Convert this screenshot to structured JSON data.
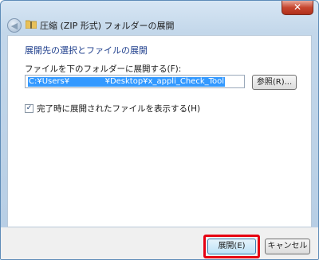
{
  "window": {
    "title": "圧縮 (ZIP 形式) フォルダーの展開",
    "close_glyph": "✕",
    "back_icon": "back-arrow-icon",
    "folder_icon": "zip-folder-icon"
  },
  "content": {
    "heading": "展開先の選択とファイルの展開",
    "destination_label": "ファイルを下のフォルダーに展開する(F):",
    "destination_value": "C:¥Users¥              ¥Desktop¥x_appli_Check_Tool",
    "browse_button": "参照(R)...",
    "show_files_checkbox": {
      "checked": true,
      "label": "完了時に展開されたファイルを表示する(H)"
    }
  },
  "footer": {
    "extract_button": "展開(E)",
    "cancel_button": "キャンセル"
  },
  "colors": {
    "highlight": "#e60012",
    "heading": "#1e3e8c",
    "selection": "#3399ff"
  }
}
